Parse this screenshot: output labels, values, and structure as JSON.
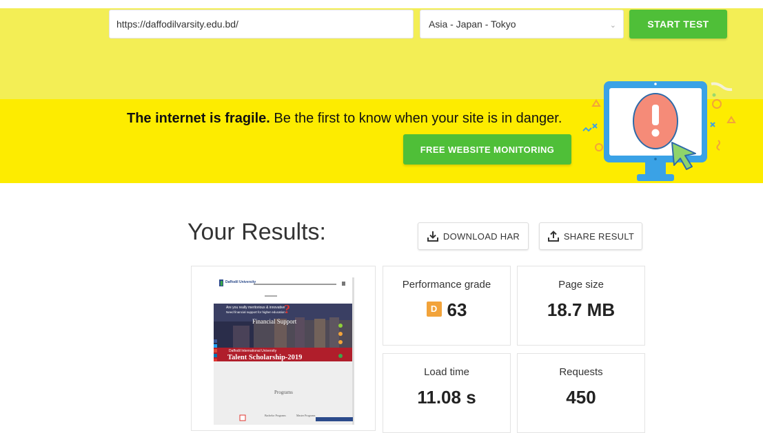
{
  "test_form": {
    "url_value": "https://daffodilvarsity.edu.bd/",
    "location_value": "Asia - Japan - Tokyo",
    "start_label": "START TEST"
  },
  "banner": {
    "headline_bold": "The internet is fragile.",
    "headline_rest": "Be the first to know when your site is in danger.",
    "button_label": "FREE WEBSITE MONITORING"
  },
  "results": {
    "title": "Your Results:",
    "download_label": "DOWNLOAD HAR",
    "share_label": "SHARE RESULT"
  },
  "metrics": {
    "performance": {
      "label": "Performance grade",
      "grade": "D",
      "value": "63"
    },
    "page_size": {
      "label": "Page size",
      "value": "18.7 MB"
    },
    "load_time": {
      "label": "Load time",
      "value": "11.08 s"
    },
    "requests": {
      "label": "Requests",
      "value": "450"
    }
  },
  "thumbnail": {
    "headline_lines": [
      "Are you really meritorious & innovative",
      "Need financial support for higher education"
    ],
    "financial_support": "Financial Support",
    "university_name": "Daffodil International University",
    "scholarship": "Talent Scholarship-2019",
    "programs": "Programs",
    "bachelor": "Bachelor Programs",
    "master": "Master Programs",
    "logo_text": "Daffodil University"
  },
  "colors": {
    "accent_green": "#4fbf38",
    "banner_yellow": "#fdec00",
    "top_yellow": "#f3ee55",
    "grade_orange": "#f2a33a"
  }
}
